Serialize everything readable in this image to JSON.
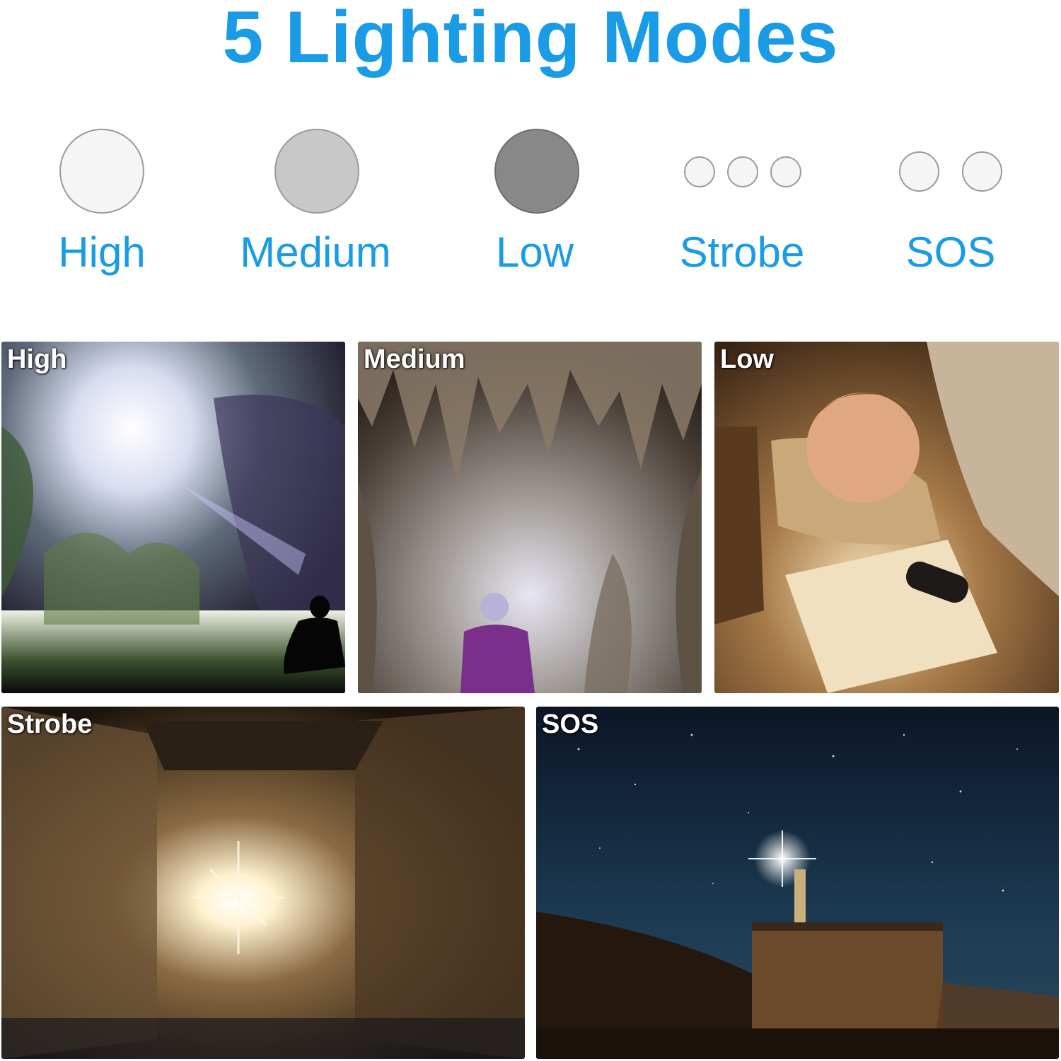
{
  "title": "5 Lighting Modes",
  "colors": {
    "accent": "#1a9be6"
  },
  "modes": [
    {
      "label": "High",
      "swatch": "#f5f5f5"
    },
    {
      "label": "Medium",
      "swatch": "#c8c8c8"
    },
    {
      "label": "Low",
      "swatch": "#888888"
    },
    {
      "label": "Strobe",
      "swatch": "#f5f5f5"
    },
    {
      "label": "SOS",
      "swatch": "#f5f5f5"
    }
  ],
  "photos": [
    {
      "label": "High"
    },
    {
      "label": "Medium"
    },
    {
      "label": "Low"
    },
    {
      "label": "Strobe"
    },
    {
      "label": "SOS"
    }
  ]
}
